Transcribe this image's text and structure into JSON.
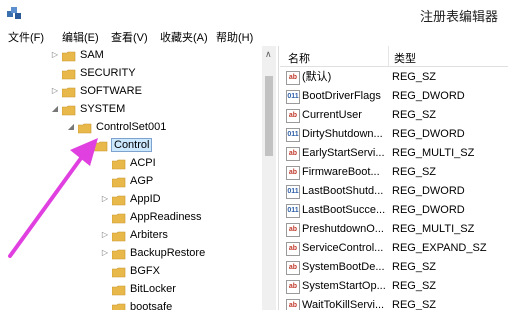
{
  "window": {
    "title": "注册表编辑器"
  },
  "menubar": {
    "items": [
      "文件(F)",
      "编辑(E)",
      "查看(V)",
      "收藏夹(A)",
      "帮助(H)"
    ]
  },
  "tree": {
    "nodes": [
      {
        "label": "SAM",
        "expander": "▷"
      },
      {
        "label": "SECURITY",
        "expander": ""
      },
      {
        "label": "SOFTWARE",
        "expander": "▷"
      },
      {
        "label": "SYSTEM",
        "expander": "◢"
      },
      {
        "label": "ControlSet001",
        "expander": "◢"
      },
      {
        "label": "Control",
        "expander": "◢",
        "selected": true
      },
      {
        "label": "ACPI",
        "expander": ""
      },
      {
        "label": "AGP",
        "expander": ""
      },
      {
        "label": "AppID",
        "expander": "▷"
      },
      {
        "label": "AppReadiness",
        "expander": ""
      },
      {
        "label": "Arbiters",
        "expander": "▷"
      },
      {
        "label": "BackupRestore",
        "expander": "▷"
      },
      {
        "label": "BGFX",
        "expander": ""
      },
      {
        "label": "BitLocker",
        "expander": ""
      },
      {
        "label": "bootsafe",
        "expander": ""
      }
    ]
  },
  "list": {
    "headers": {
      "name": "名称",
      "type": "类型"
    },
    "rows": [
      {
        "icon": "ab",
        "kind": "sz",
        "name": "(默认)",
        "type": "REG_SZ"
      },
      {
        "icon": "011",
        "kind": "bin",
        "name": "BootDriverFlags",
        "type": "REG_DWORD"
      },
      {
        "icon": "ab",
        "kind": "sz",
        "name": "CurrentUser",
        "type": "REG_SZ"
      },
      {
        "icon": "011",
        "kind": "bin",
        "name": "DirtyShutdown...",
        "type": "REG_DWORD"
      },
      {
        "icon": "ab",
        "kind": "sz",
        "name": "EarlyStartServi...",
        "type": "REG_MULTI_SZ"
      },
      {
        "icon": "ab",
        "kind": "sz",
        "name": "FirmwareBoot...",
        "type": "REG_SZ"
      },
      {
        "icon": "011",
        "kind": "bin",
        "name": "LastBootShutd...",
        "type": "REG_DWORD"
      },
      {
        "icon": "011",
        "kind": "bin",
        "name": "LastBootSucce...",
        "type": "REG_DWORD"
      },
      {
        "icon": "ab",
        "kind": "sz",
        "name": "PreshutdownO...",
        "type": "REG_MULTI_SZ"
      },
      {
        "icon": "ab",
        "kind": "sz",
        "name": "ServiceControl...",
        "type": "REG_EXPAND_SZ"
      },
      {
        "icon": "ab",
        "kind": "sz",
        "name": "SystemBootDe...",
        "type": "REG_SZ"
      },
      {
        "icon": "ab",
        "kind": "sz",
        "name": "SystemStartOp...",
        "type": "REG_SZ"
      },
      {
        "icon": "ab",
        "kind": "sz",
        "name": "WaitToKillServi...",
        "type": "REG_SZ"
      }
    ]
  },
  "colors": {
    "arrow": "#e040e0",
    "folder": "#e8b84a",
    "selection": "#cce8ff"
  },
  "icons": {
    "app": "regedit-icon",
    "folder": "folder-icon"
  }
}
